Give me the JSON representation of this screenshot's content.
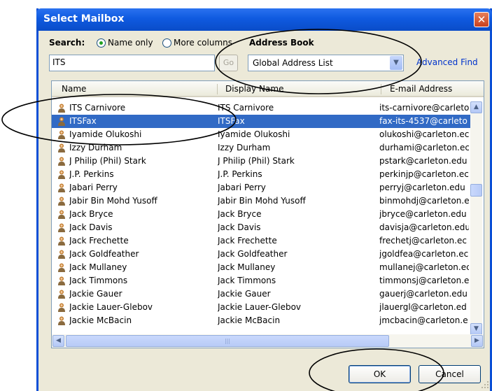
{
  "window": {
    "title": "Select Mailbox",
    "close_glyph": "✕"
  },
  "search": {
    "label": "Search:",
    "option_name_only": "Name only",
    "option_more_columns": "More columns",
    "selected_option": "Name only",
    "query_value": "ITS",
    "go_label": "Go"
  },
  "address_book": {
    "label": "Address Book",
    "selected": "Global Address List",
    "advanced_find": "Advanced Find"
  },
  "list": {
    "columns": [
      "Name",
      "Display Name",
      "E-mail Address"
    ],
    "selected_index": 1,
    "rows": [
      {
        "name": "ITS Carnivore",
        "display": "ITS Carnivore",
        "email": "its-carnivore@carleto"
      },
      {
        "name": "ITSFax",
        "display": "ITSFax",
        "email": "fax-its-4537@carleto"
      },
      {
        "name": "Iyamide Olukoshi",
        "display": "Iyamide Olukoshi",
        "email": "olukoshi@carleton.ec"
      },
      {
        "name": "Izzy Durham",
        "display": "Izzy Durham",
        "email": "durhami@carleton.ec"
      },
      {
        "name": "J Philip (Phil) Stark",
        "display": "J Philip (Phil) Stark",
        "email": "pstark@carleton.edu"
      },
      {
        "name": "J.P. Perkins",
        "display": "J.P. Perkins",
        "email": "perkinjp@carleton.ec"
      },
      {
        "name": "Jabari Perry",
        "display": "Jabari Perry",
        "email": "perryj@carleton.edu"
      },
      {
        "name": "Jabir Bin Mohd Yusoff",
        "display": "Jabir Bin Mohd Yusoff",
        "email": "binmohdj@carleton.e"
      },
      {
        "name": "Jack Bryce",
        "display": "Jack Bryce",
        "email": "jbryce@carleton.edu"
      },
      {
        "name": "Jack Davis",
        "display": "Jack Davis",
        "email": "davisja@carleton.edu"
      },
      {
        "name": "Jack Frechette",
        "display": "Jack Frechette",
        "email": "frechetj@carleton.ec"
      },
      {
        "name": "Jack Goldfeather",
        "display": "Jack Goldfeather",
        "email": "jgoldfea@carleton.ec"
      },
      {
        "name": "Jack Mullaney",
        "display": "Jack Mullaney",
        "email": "mullanej@carleton.ec"
      },
      {
        "name": "Jack Timmons",
        "display": "Jack Timmons",
        "email": "timmonsj@carleton.e"
      },
      {
        "name": "Jackie Gauer",
        "display": "Jackie Gauer",
        "email": "gauerj@carleton.edu"
      },
      {
        "name": "Jackie Lauer-Glebov",
        "display": "Jackie Lauer-Glebov",
        "email": "jlauergl@carleton.ed"
      },
      {
        "name": "Jackie McBacin",
        "display": "Jackie McBacin",
        "email": "jmcbacin@carleton.e"
      }
    ]
  },
  "buttons": {
    "ok": "OK",
    "cancel": "Cancel"
  },
  "colors": {
    "titlebar": "#0a4cc8",
    "selection": "#316ac5",
    "dialog_bg": "#ece9d8",
    "link": "#0033cc"
  },
  "icons": [
    "close-icon",
    "contact-icon",
    "dropdown-arrow-icon",
    "scroll-up-icon",
    "scroll-down-icon",
    "scroll-left-icon",
    "scroll-right-icon",
    "resize-grip-icon"
  ]
}
